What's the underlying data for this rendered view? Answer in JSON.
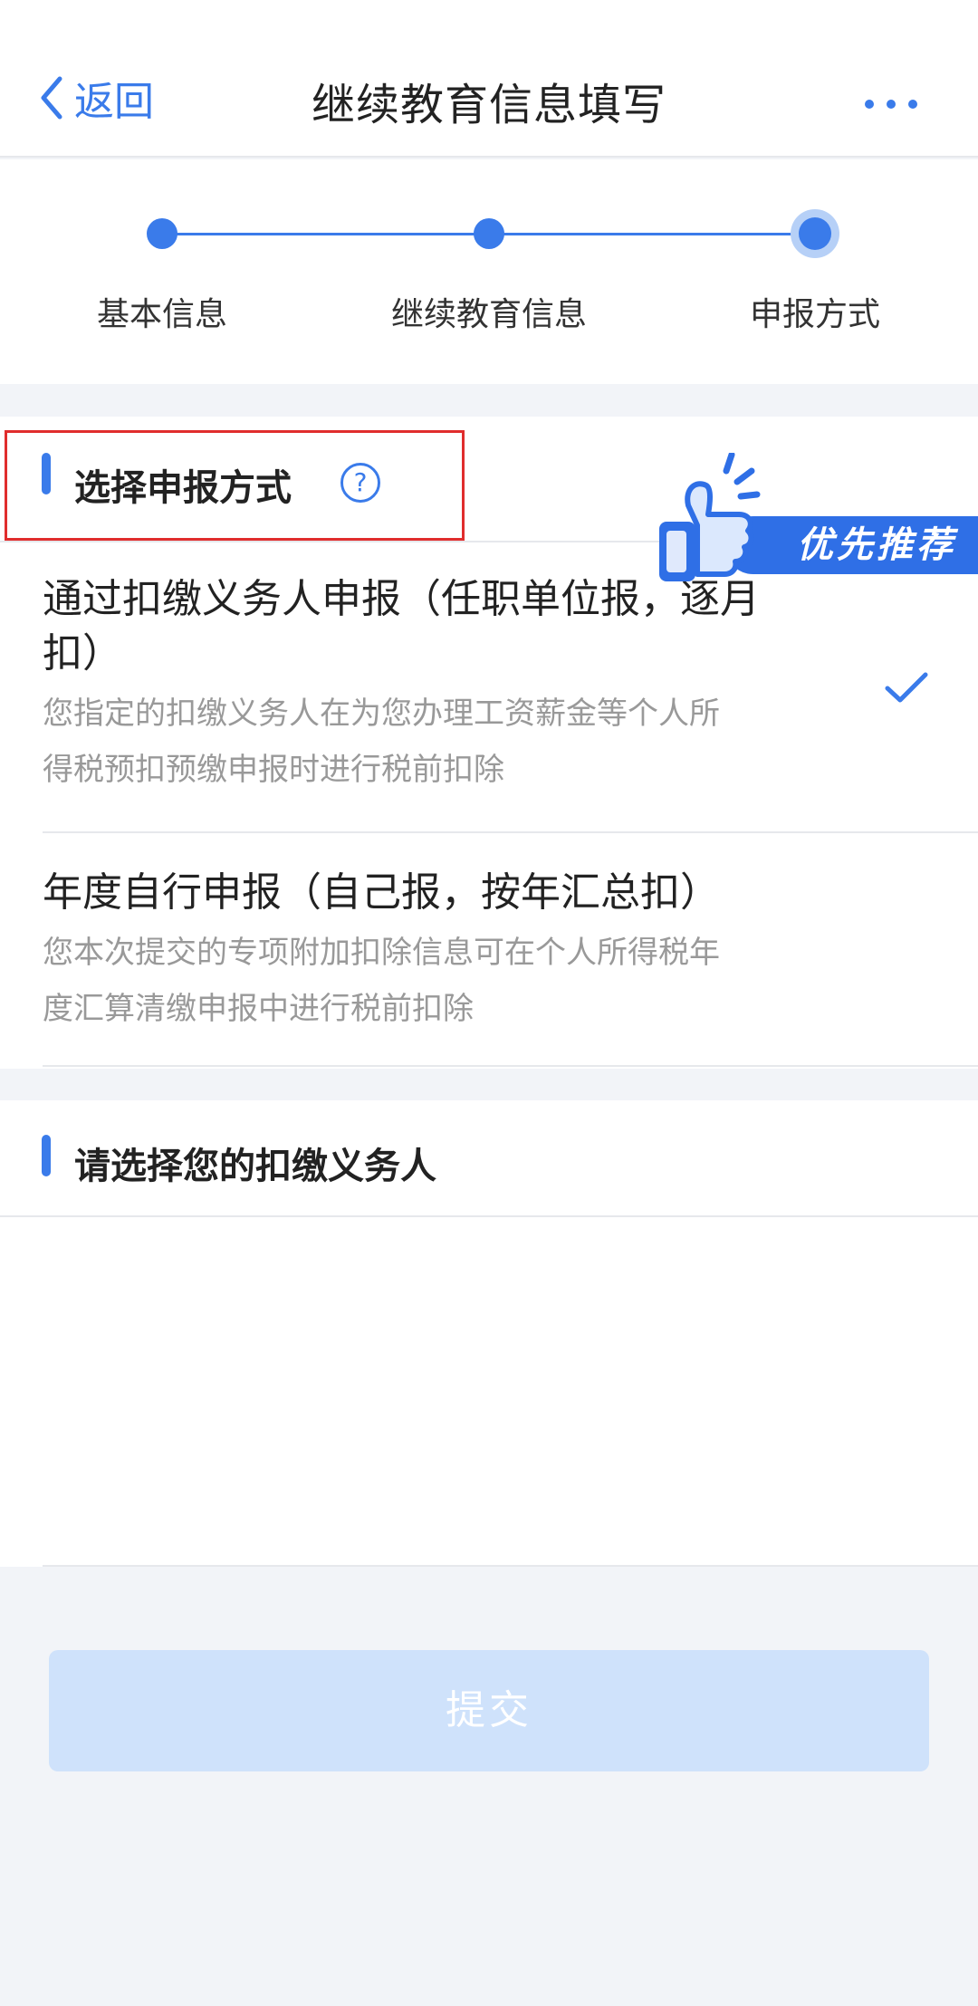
{
  "header": {
    "back_label": "返回",
    "title": "继续教育信息填写"
  },
  "steps": [
    {
      "label": "基本信息",
      "state": "done"
    },
    {
      "label": "继续教育信息",
      "state": "done"
    },
    {
      "label": "申报方式",
      "state": "active"
    }
  ],
  "section_method": {
    "title": "选择申报方式",
    "help_glyph": "?",
    "badge_label": "优先推荐",
    "options": [
      {
        "title_line1": "通过扣缴义务人申报（任职单位报，逐月",
        "title_line2": "扣）",
        "desc_line1": "您指定的扣缴义务人在为您办理工资薪金等个人所",
        "desc_line2": "得税预扣预缴申报时进行税前扣除",
        "selected": true
      },
      {
        "title_line1": "年度自行申报（自己报，按年汇总扣）",
        "desc_line1": "您本次提交的专项附加扣除信息可在个人所得税年",
        "desc_line2": "度汇算清缴申报中进行税前扣除",
        "selected": false
      }
    ]
  },
  "section_withholder": {
    "title": "请选择您的扣缴义务人"
  },
  "submit_label": "提交",
  "colors": {
    "accent": "#3a7bea",
    "highlight_border": "#e02d2d",
    "submit_disabled": "#cfe2fb"
  }
}
